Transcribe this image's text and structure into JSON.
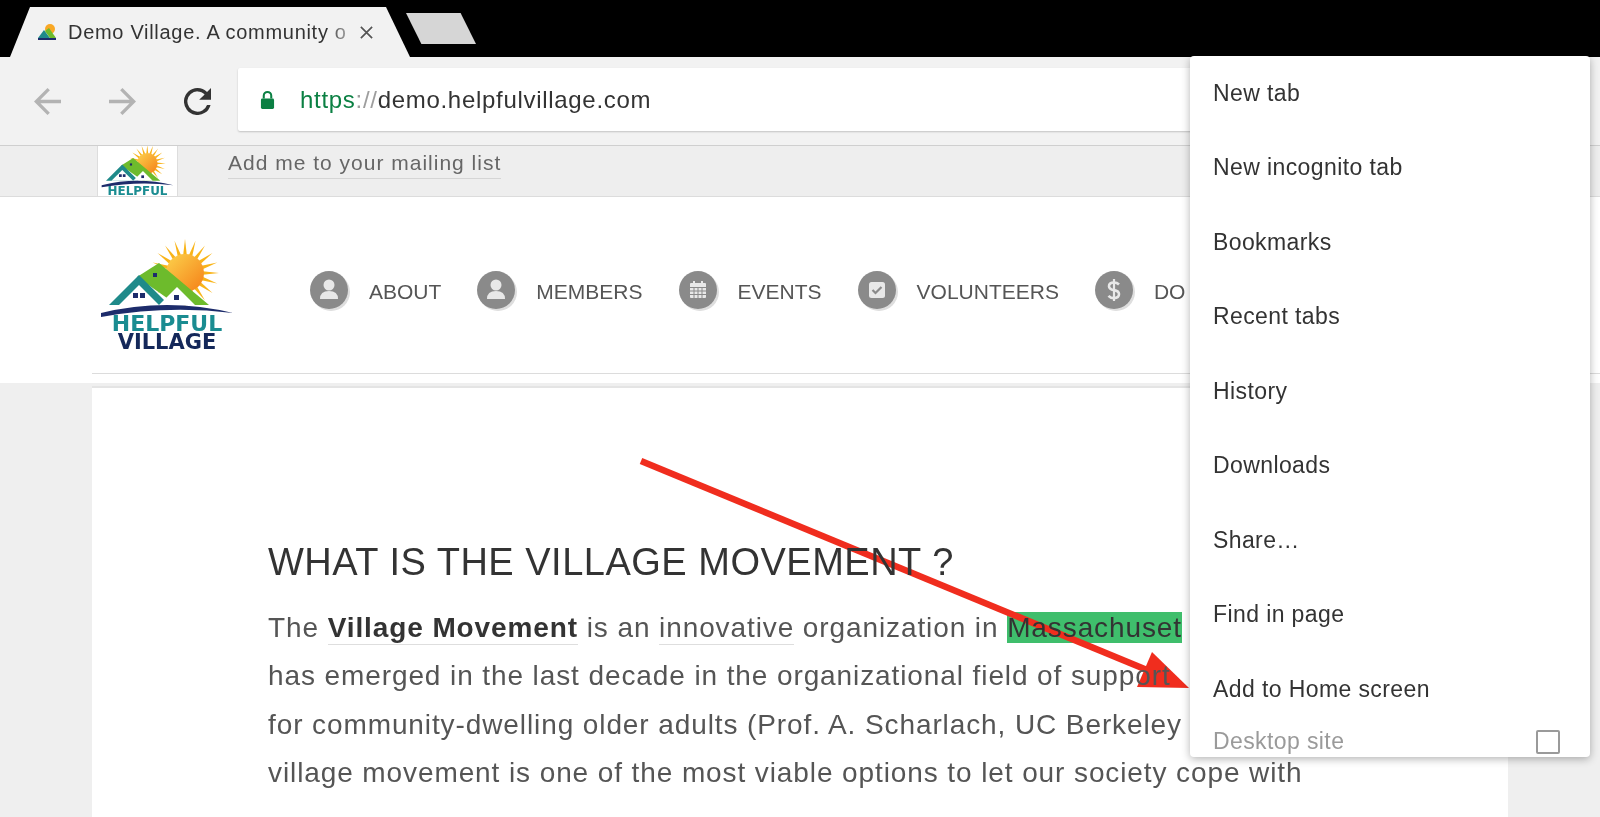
{
  "browser": {
    "tabs": [
      {
        "title": "Demo Village. A community o",
        "selected": true
      }
    ],
    "toolbar_buttons": [
      {
        "kind": "back",
        "disabled": true
      },
      {
        "kind": "forward",
        "disabled": true
      },
      {
        "kind": "reload",
        "disabled": false
      }
    ],
    "address": {
      "secure": true,
      "scheme": "https",
      "separator": "://",
      "host": "demo.helpfulvillage.com"
    }
  },
  "page": {
    "top_bar": {
      "logo": {
        "line_1": "HELPFUL"
      },
      "link": "Add me to your mailing list"
    },
    "header": {
      "logo": {
        "line_1": "HELPFUL",
        "line_2": "VILLAGE"
      },
      "nav": [
        {
          "kind": "person",
          "label": "ABOUT"
        },
        {
          "kind": "person",
          "label": "MEMBERS"
        },
        {
          "kind": "calendar",
          "label": "EVENTS"
        },
        {
          "kind": "check",
          "label": "VOLUNTEERS"
        },
        {
          "kind": "dollar",
          "label": "DO"
        }
      ]
    },
    "article": {
      "heading": "WHAT IS THE VILLAGE MOVEMENT ?",
      "lines": [
        {
          "segments": [
            {
              "kind": "plain",
              "text": "The "
            },
            {
              "kind": "strong_link",
              "text": "Village Movement"
            },
            {
              "kind": "plain",
              "text": " is an "
            },
            {
              "kind": "link",
              "text": "innovative"
            },
            {
              "kind": "plain",
              "text": " organization in "
            },
            {
              "kind": "highlight",
              "text": "Massachuset"
            }
          ]
        },
        {
          "segments": [
            {
              "kind": "plain",
              "text": "has emerged in the last decade in the organizational field of support"
            }
          ]
        },
        {
          "segments": [
            {
              "kind": "plain",
              "text": "for community-dwelling older adults (Prof. A. Scharlach, UC Berkeley"
            }
          ]
        },
        {
          "segments": [
            {
              "kind": "plain",
              "text": "village movement is one of the most viable options to let our society cope with"
            }
          ]
        }
      ]
    }
  },
  "menu": {
    "items": [
      {
        "kind": "action",
        "label": "New tab"
      },
      {
        "kind": "action",
        "label": "New incognito tab"
      },
      {
        "kind": "action",
        "label": "Bookmarks"
      },
      {
        "kind": "action",
        "label": "Recent tabs"
      },
      {
        "kind": "action",
        "label": "History"
      },
      {
        "kind": "action",
        "label": "Downloads"
      },
      {
        "kind": "action",
        "label": "Share…"
      },
      {
        "kind": "action",
        "label": "Find in page"
      },
      {
        "kind": "action",
        "label": "Add to Home screen"
      },
      {
        "kind": "checkbox",
        "label": "Desktop site",
        "checked": false
      }
    ]
  }
}
